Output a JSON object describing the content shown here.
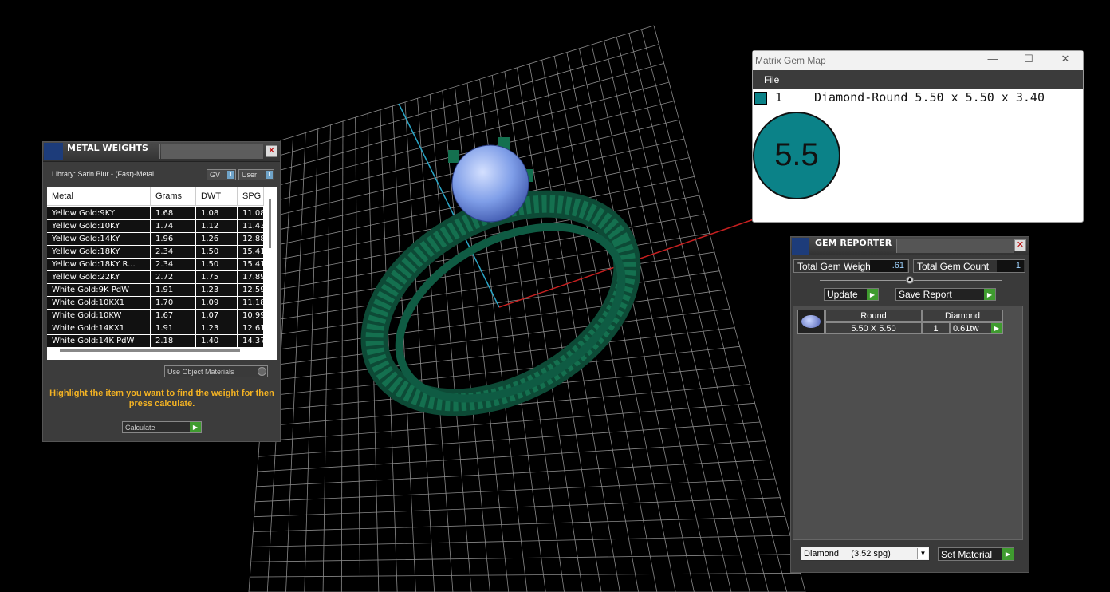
{
  "metal_weights": {
    "title": "METAL WEIGHTS",
    "library": "Library: Satin Blur - (Fast)-Metal",
    "gv_label": "GV",
    "user_label": "User",
    "columns": [
      "Metal",
      "Grams",
      "DWT",
      "SPG"
    ],
    "rows": [
      [
        "Yellow Gold:9KY",
        "1.68",
        "1.08",
        "11.08"
      ],
      [
        "Yellow Gold:10KY",
        "1.74",
        "1.12",
        "11.43"
      ],
      [
        "Yellow Gold:14KY",
        "1.96",
        "1.26",
        "12.88"
      ],
      [
        "Yellow Gold:18KY",
        "2.34",
        "1.50",
        "15.41"
      ],
      [
        "Yellow Gold:18KY R...",
        "2.34",
        "1.50",
        "15.41"
      ],
      [
        "Yellow Gold:22KY",
        "2.72",
        "1.75",
        "17.89"
      ],
      [
        "White Gold:9K PdW",
        "1.91",
        "1.23",
        "12.59"
      ],
      [
        "White Gold:10KX1",
        "1.70",
        "1.09",
        "11.18"
      ],
      [
        "White Gold:10KW",
        "1.67",
        "1.07",
        "10.99"
      ],
      [
        "White Gold:14KX1",
        "1.91",
        "1.23",
        "12.61"
      ],
      [
        "White Gold:14K PdW",
        "2.18",
        "1.40",
        "14.37"
      ]
    ],
    "use_object_materials": "Use Object Materials",
    "hint": "Highlight the item you want to find the weight for then press calculate.",
    "calculate_label": "Calculate",
    "close_glyph": "✕"
  },
  "gem_map": {
    "title": "Matrix Gem Map",
    "menu_file": "File",
    "gem_index": "1",
    "gem_description": "Diamond-Round 5.50 x 5.50 x 3.40",
    "gem_size_label": "5.5",
    "swatch_color": "#0b8288",
    "controls": {
      "minimize": "—",
      "maximize": "☐",
      "close": "✕"
    }
  },
  "gem_reporter": {
    "title": "GEM REPORTER",
    "total_weight_label": "Total Gem Weight",
    "total_weight_value": ".61",
    "total_count_label": "Total Gem Count",
    "total_count_value": "1",
    "update_label": "Update",
    "save_report_label": "Save Report",
    "table_headers": [
      "Round",
      "Diamond"
    ],
    "row": {
      "size": "5.50 X 5.50",
      "count": "1",
      "weight": "0.61tw"
    },
    "material_select": "Diamond     (3.52 spg)",
    "set_material_label": "Set Material",
    "close_glyph": "✕"
  },
  "colors": {
    "ring_green": "#0f5b43",
    "gem_blue": "#7a9de6",
    "accent_gold": "#f4b323",
    "go_green": "#3f9b2f"
  }
}
